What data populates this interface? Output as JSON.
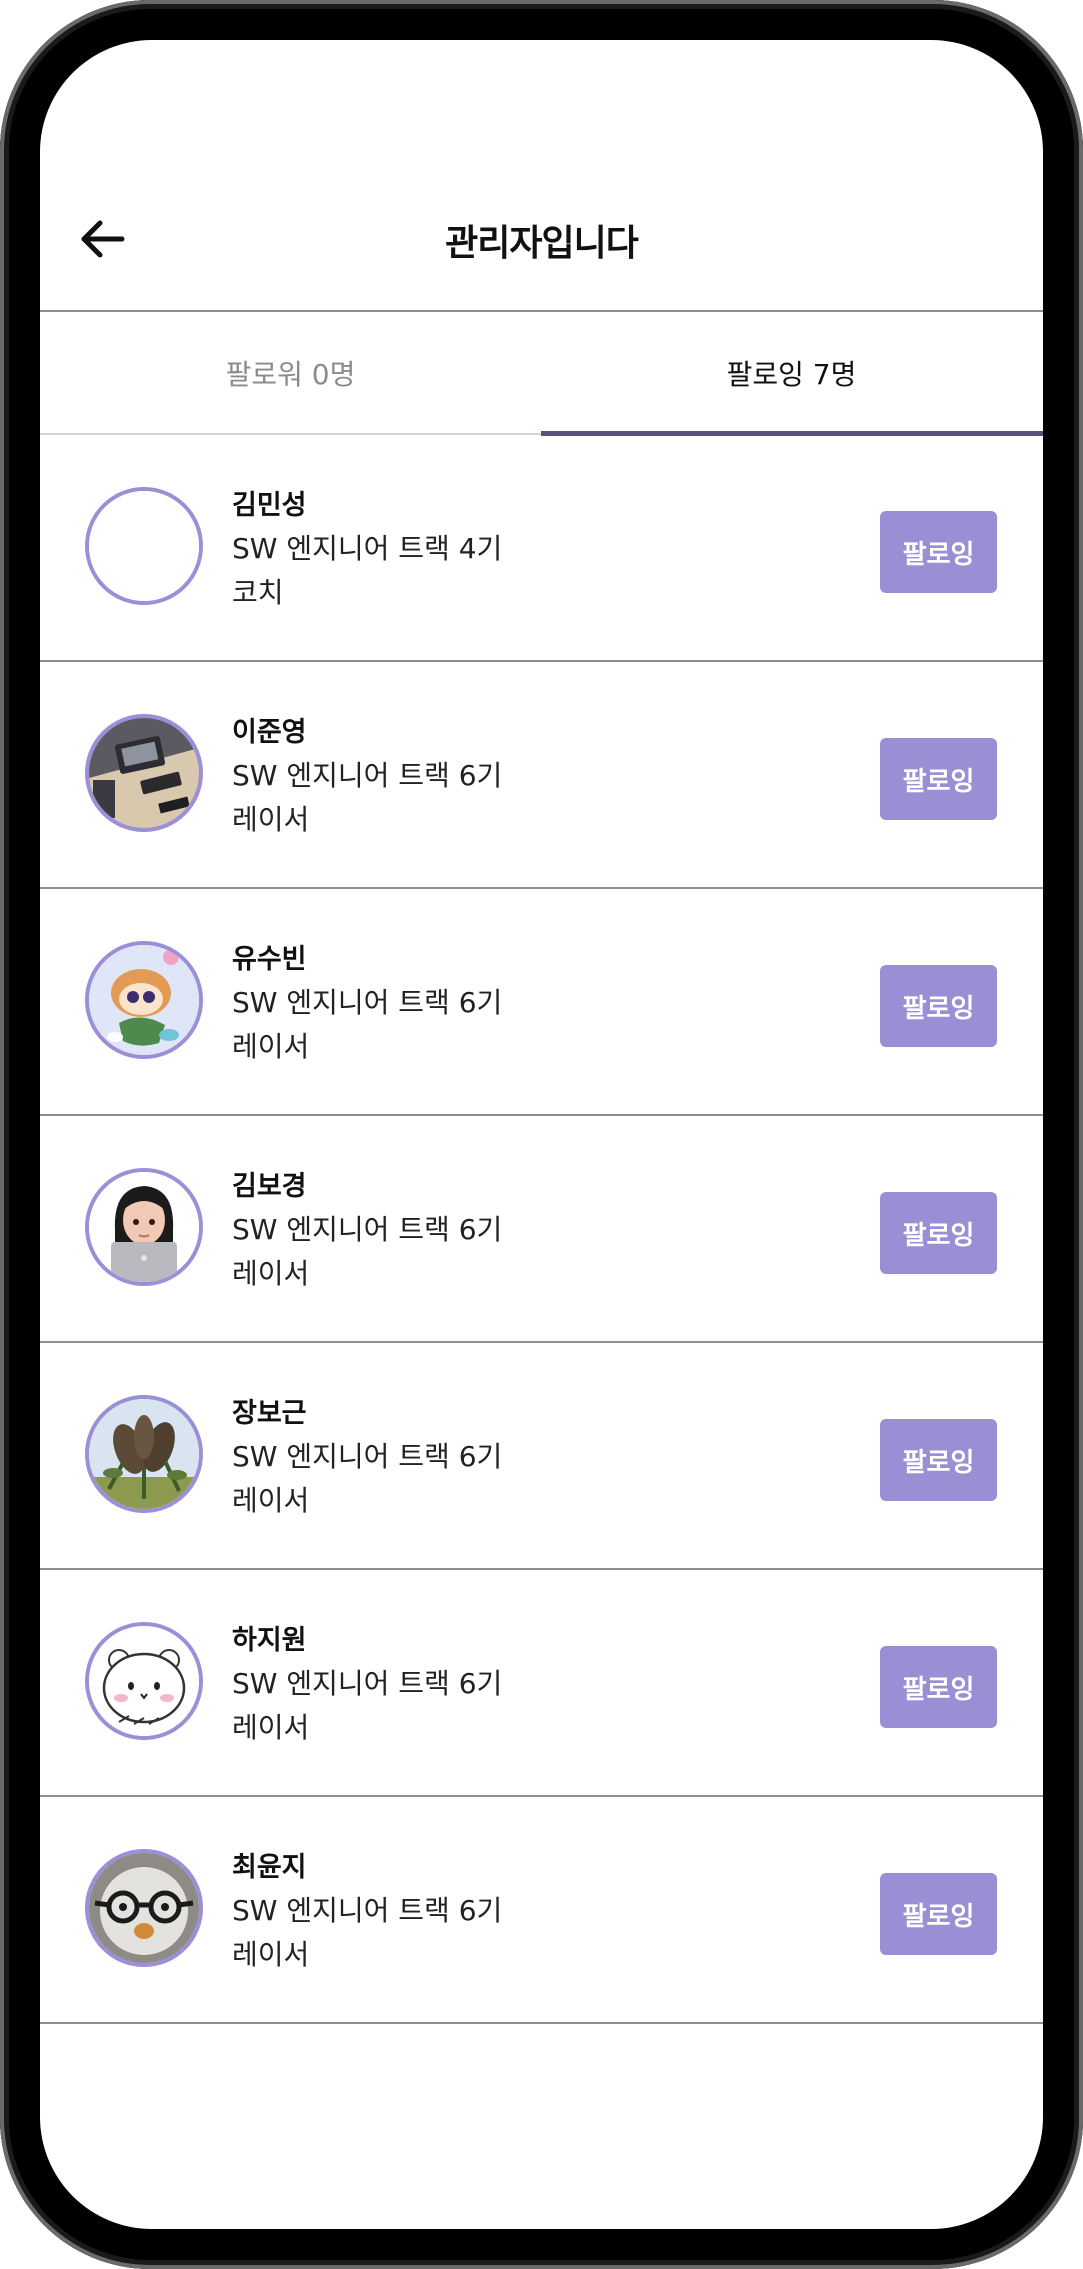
{
  "header": {
    "title": "관리자입니다",
    "back_icon": "arrow-left-icon"
  },
  "tabs": [
    {
      "label": "팔로워 0명",
      "active": false
    },
    {
      "label": "팔로잉 7명",
      "active": true
    }
  ],
  "users": [
    {
      "name": "김민성",
      "track": "SW 엔지니어 트랙 4기",
      "role": "코치",
      "button": "팔로잉",
      "avatar": "empty-avatar"
    },
    {
      "name": "이준영",
      "track": "SW 엔지니어 트랙 6기",
      "role": "레이서",
      "button": "팔로잉",
      "avatar": "desk-photo-avatar"
    },
    {
      "name": "유수빈",
      "track": "SW 엔지니어 트랙 6기",
      "role": "레이서",
      "button": "팔로잉",
      "avatar": "cartoon-character-avatar"
    },
    {
      "name": "김보경",
      "track": "SW 엔지니어 트랙 6기",
      "role": "레이서",
      "button": "팔로잉",
      "avatar": "memoji-laptop-avatar"
    },
    {
      "name": "장보근",
      "track": "SW 엔지니어 트랙 6기",
      "role": "레이서",
      "button": "팔로잉",
      "avatar": "plant-photo-avatar"
    },
    {
      "name": "하지원",
      "track": "SW 엔지니어 트랙 6기",
      "role": "레이서",
      "button": "팔로잉",
      "avatar": "white-bear-avatar"
    },
    {
      "name": "최윤지",
      "track": "SW 엔지니어 트랙 6기",
      "role": "레이서",
      "button": "팔로잉",
      "avatar": "glasses-bird-avatar"
    }
  ],
  "colors": {
    "accent": "#9a8fd4",
    "tab_indicator": "#575279",
    "avatar_border": "#9b8fd7"
  }
}
